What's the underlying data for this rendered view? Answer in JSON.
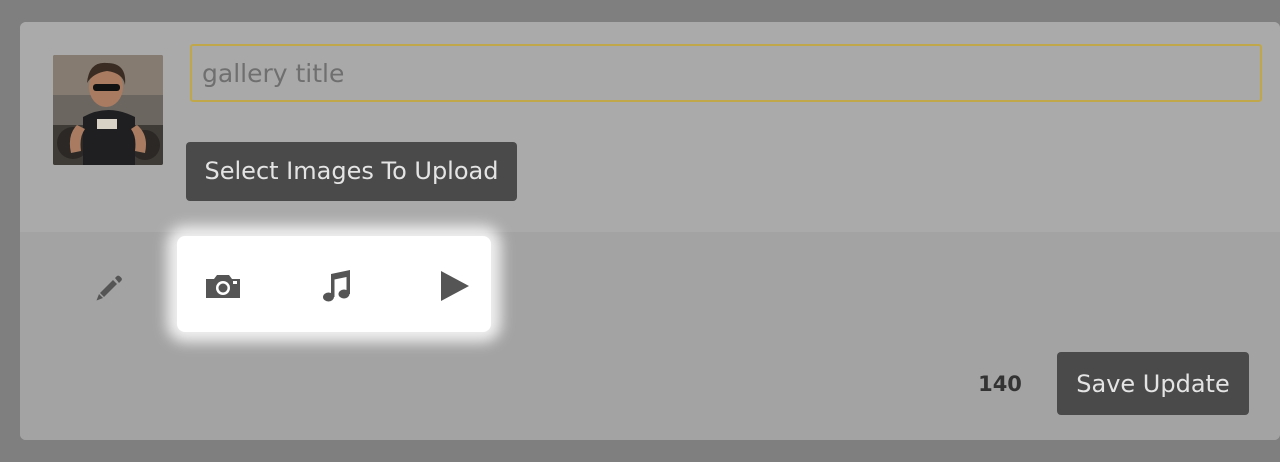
{
  "composer": {
    "title_placeholder": "gallery title",
    "title_value": "",
    "upload_tooltip": "Select Images To Upload",
    "char_count": "140",
    "save_label": "Save Update"
  },
  "toolbar": {
    "tools": [
      {
        "icon": "pencil-icon"
      },
      {
        "icon": "camera-icon"
      },
      {
        "icon": "music-note-icon"
      },
      {
        "icon": "play-icon"
      }
    ]
  },
  "colors": {
    "accent_border": "#c0a84a",
    "button_bg": "#4a4a4a",
    "highlight": "#ffffff"
  }
}
